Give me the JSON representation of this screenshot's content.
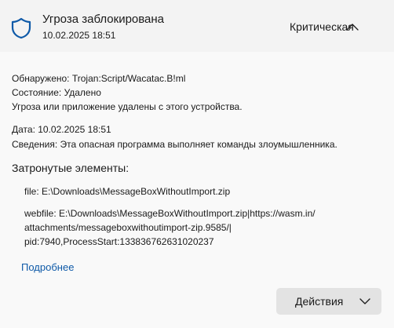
{
  "header": {
    "title": "Угроза заблокирована",
    "date": "10.02.2025 18:51",
    "severity": "Критическая",
    "icon": "shield-icon",
    "expand_icon": "chevron-up-icon",
    "accent_color": "#0f5aa8"
  },
  "details": {
    "detected_label": "Обнаружено:",
    "detected_value": "Trojan:Script/Wacatac.B!ml",
    "status_label": "Состояние:",
    "status_value": "Удалено",
    "status_note": "Угроза или приложение удалены с этого устройства.",
    "date_label": "Дата:",
    "date_value": "10.02.2025 18:51",
    "info_label": "Сведения:",
    "info_value": "Эта опасная программа выполняет команды злоумышленника."
  },
  "affected": {
    "title": "Затронутые элементы:",
    "file_line": "file: E:\\Downloads\\MessageBoxWithoutImport.zip",
    "webfile_line1": "webfile: E:\\Downloads\\MessageBoxWithoutImport.zip|https://wasm.in/",
    "webfile_line2": "attachments/messageboxwithoutimport-zip.9585/|",
    "webfile_line3": "pid:7940,ProcessStart:133836762631020237"
  },
  "more_link": "Подробнее",
  "actions_button": {
    "label": "Действия",
    "icon": "chevron-down-icon"
  }
}
